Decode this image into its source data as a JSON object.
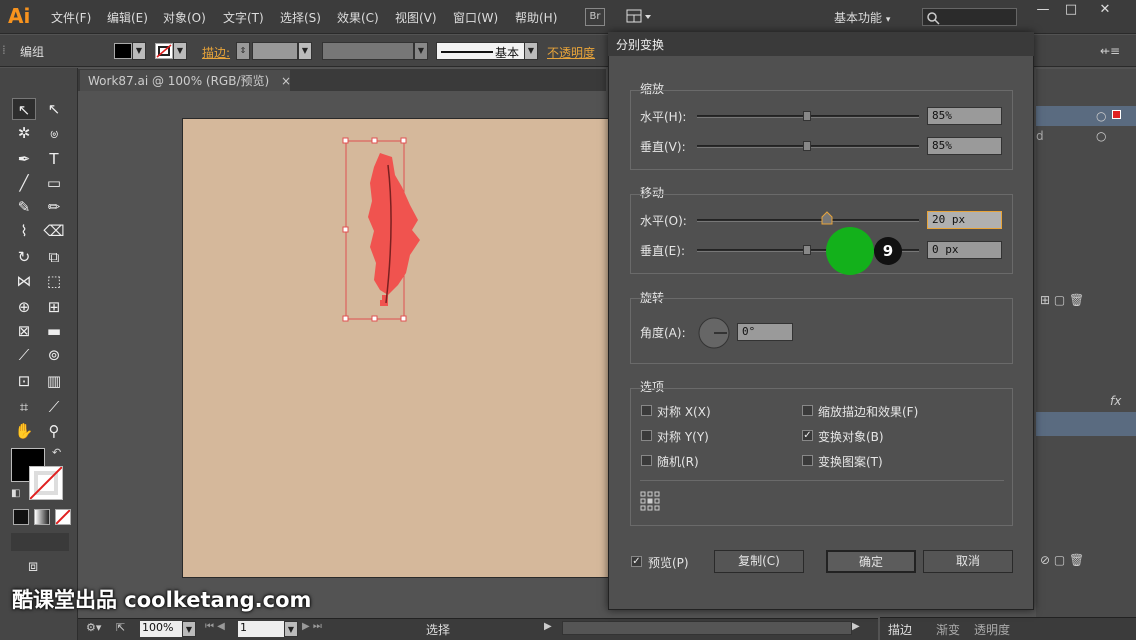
{
  "app": {
    "logo": "Ai"
  },
  "menu": [
    "文件(F)",
    "编辑(E)",
    "对象(O)",
    "文字(T)",
    "选择(S)",
    "效果(C)",
    "视图(V)",
    "窗口(W)",
    "帮助(H)"
  ],
  "bridge_label": "Br",
  "workspace_label": "基本功能",
  "window_controls": [
    "—",
    "□",
    "✕"
  ],
  "control_bar": {
    "selection_type": "编组",
    "stroke_label": "描边:",
    "stroke_style_label": "基本",
    "opacity_label": "不透明度"
  },
  "document_tab": {
    "title": "Work87.ai @ 100% (RGB/预览)",
    "close": "×"
  },
  "status_bar": {
    "zoom": "100%",
    "page": "1",
    "tool": "选择"
  },
  "dialog": {
    "title": "分别变换",
    "scale": {
      "title": "缩放",
      "horizontal_label": "水平(H):",
      "horizontal_value": "85%",
      "horizontal_slider": 0.5,
      "vertical_label": "垂直(V):",
      "vertical_value": "85%",
      "vertical_slider": 0.5
    },
    "move": {
      "title": "移动",
      "horizontal_label": "水平(O):",
      "horizontal_value": "20 px",
      "horizontal_slider": 0.58,
      "vertical_label": "垂直(E):",
      "vertical_value": "0 px",
      "vertical_slider": 0.5
    },
    "rotate": {
      "title": "旋转",
      "angle_label": "角度(A):",
      "angle_value": "0°"
    },
    "options": {
      "title": "选项",
      "reflect_x": {
        "label": "对称 X(X)",
        "checked": false
      },
      "reflect_y": {
        "label": "对称 Y(Y)",
        "checked": false
      },
      "random": {
        "label": "随机(R)",
        "checked": false
      },
      "scale_strokes": {
        "label": "缩放描边和效果(F)",
        "checked": false
      },
      "transform_objects": {
        "label": "变换对象(B)",
        "checked": true
      },
      "transform_patterns": {
        "label": "变换图案(T)",
        "checked": false
      }
    },
    "preview": {
      "label": "预览(P)",
      "checked": true
    },
    "copy_button": "复制(C)",
    "ok_button": "确定",
    "cancel_button": "取消"
  },
  "click_marker": {
    "number": "9",
    "color": "#13b11b"
  },
  "right_panel": {
    "fx_label": "fx",
    "d_label": "d",
    "tabs": [
      "描边",
      "渐变",
      "透明度"
    ]
  },
  "watermark": "酷课堂出品 coolketang.com",
  "colors": {
    "accent_orange": "#e8a43a",
    "artboard": "#d5b89b",
    "leaf": "#f0534f"
  }
}
